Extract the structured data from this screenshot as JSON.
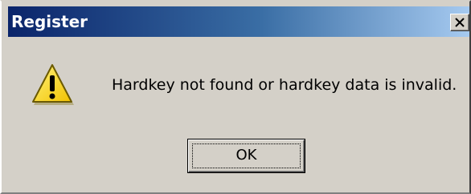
{
  "window": {
    "title": "Register",
    "close_icon": "close-x-icon"
  },
  "dialog": {
    "icon": "warning-icon",
    "message": "Hardkey not found or hardkey data is invalid.",
    "ok_label": "OK"
  },
  "colors": {
    "titlebar_start": "#0a246a",
    "titlebar_end": "#a6caf0",
    "face": "#d4d0c8",
    "warning_yellow": "#ffde00"
  }
}
